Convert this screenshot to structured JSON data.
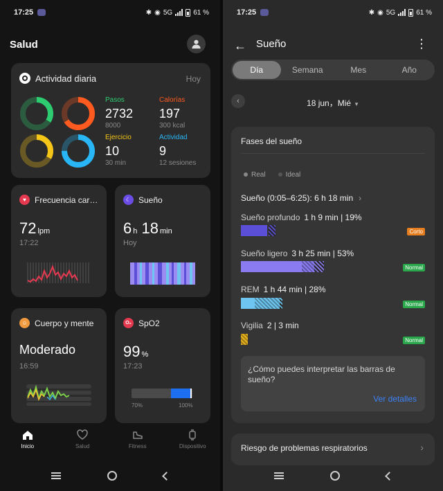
{
  "left": {
    "status": {
      "time": "17:25",
      "network": "5G",
      "battery": "61 %"
    },
    "title": "Salud",
    "activity": {
      "title": "Actividad diaria",
      "day": "Hoy",
      "metrics": [
        {
          "label": "Pasos",
          "value": "2732",
          "goal": "8000",
          "color": "#2ecc71",
          "progress": 0.34
        },
        {
          "label": "Calorías",
          "value": "197",
          "goal": "300 kcal",
          "color": "#ff5a1f",
          "progress": 0.66
        },
        {
          "label": "Ejercicio",
          "value": "10",
          "goal": "30 min",
          "color": "#f5c518",
          "progress": 0.33
        },
        {
          "label": "Actividad",
          "value": "9",
          "goal": "12 sesiones",
          "color": "#29b6f6",
          "progress": 0.75
        }
      ]
    },
    "heart": {
      "title": "Frecuencia car…",
      "value": "72",
      "unit": "lpm",
      "time": "17:22",
      "color": "#e53950"
    },
    "sleep": {
      "title": "Sueño",
      "hours": "6",
      "h_unit": "h",
      "minutes": "18",
      "m_unit": "min",
      "day": "Hoy",
      "color": "#6b4de6"
    },
    "mind": {
      "title": "Cuerpo y mente",
      "value": "Moderado",
      "time": "16:59",
      "color": "#f29a3e"
    },
    "spo2": {
      "title": "SpO2",
      "icon_text": "O₂",
      "value": "99",
      "unit": "%",
      "time": "17:23",
      "min_label": "70%",
      "max_label": "100%",
      "color": "#e53950",
      "level": 0.97
    },
    "tabs": [
      {
        "label": "Inicio",
        "icon": "home-icon"
      },
      {
        "label": "Salud",
        "icon": "heart-icon"
      },
      {
        "label": "Fitness",
        "icon": "shoe-icon"
      },
      {
        "label": "Dispositivo",
        "icon": "watch-icon"
      }
    ]
  },
  "right": {
    "status": {
      "time": "17:25",
      "network": "5G",
      "battery": "61 %"
    },
    "title": "Sueño",
    "segments": [
      "Día",
      "Semana",
      "Mes",
      "Año"
    ],
    "active_segment": "Día",
    "date": "18 jun，Mié",
    "phases": {
      "title": "Fases del sueño",
      "legend_real": "Real",
      "legend_ideal": "Ideal",
      "total": "Sueño (0:05–6:25): 6 h 18 min",
      "rows": [
        {
          "name": "Sueño profundo",
          "detail": "1 h 9 min | 19%",
          "badge": "Corto",
          "badge_type": "corto",
          "color": "#5a4fd6",
          "real": 0.19,
          "ideal_from": 0.2,
          "ideal_to": 0.25
        },
        {
          "name": "Sueño ligero",
          "detail": "3 h 25 min | 53%",
          "badge": "Normal",
          "badge_type": "normal",
          "color": "#8a7cf0",
          "real": 0.53,
          "ideal_from": 0.44,
          "ideal_to": 0.6
        },
        {
          "name": "REM",
          "detail": "1 h 44 min | 28%",
          "badge": "Normal",
          "badge_type": "normal",
          "color": "#6ec6f0",
          "real": 0.28,
          "ideal_from": 0.1,
          "ideal_to": 0.3
        },
        {
          "name": "Vigilia",
          "detail": "2 | 3 min",
          "badge": "Normal",
          "badge_type": "normal",
          "color": "#e6b31f",
          "real": 0.01,
          "ideal_from": 0.0,
          "ideal_to": 0.05
        }
      ],
      "info_question": "¿Cómo puedes interpretar las barras de sueño?",
      "info_link": "Ver detalles"
    },
    "riesgo": "Riesgo de problemas respiratorios"
  }
}
